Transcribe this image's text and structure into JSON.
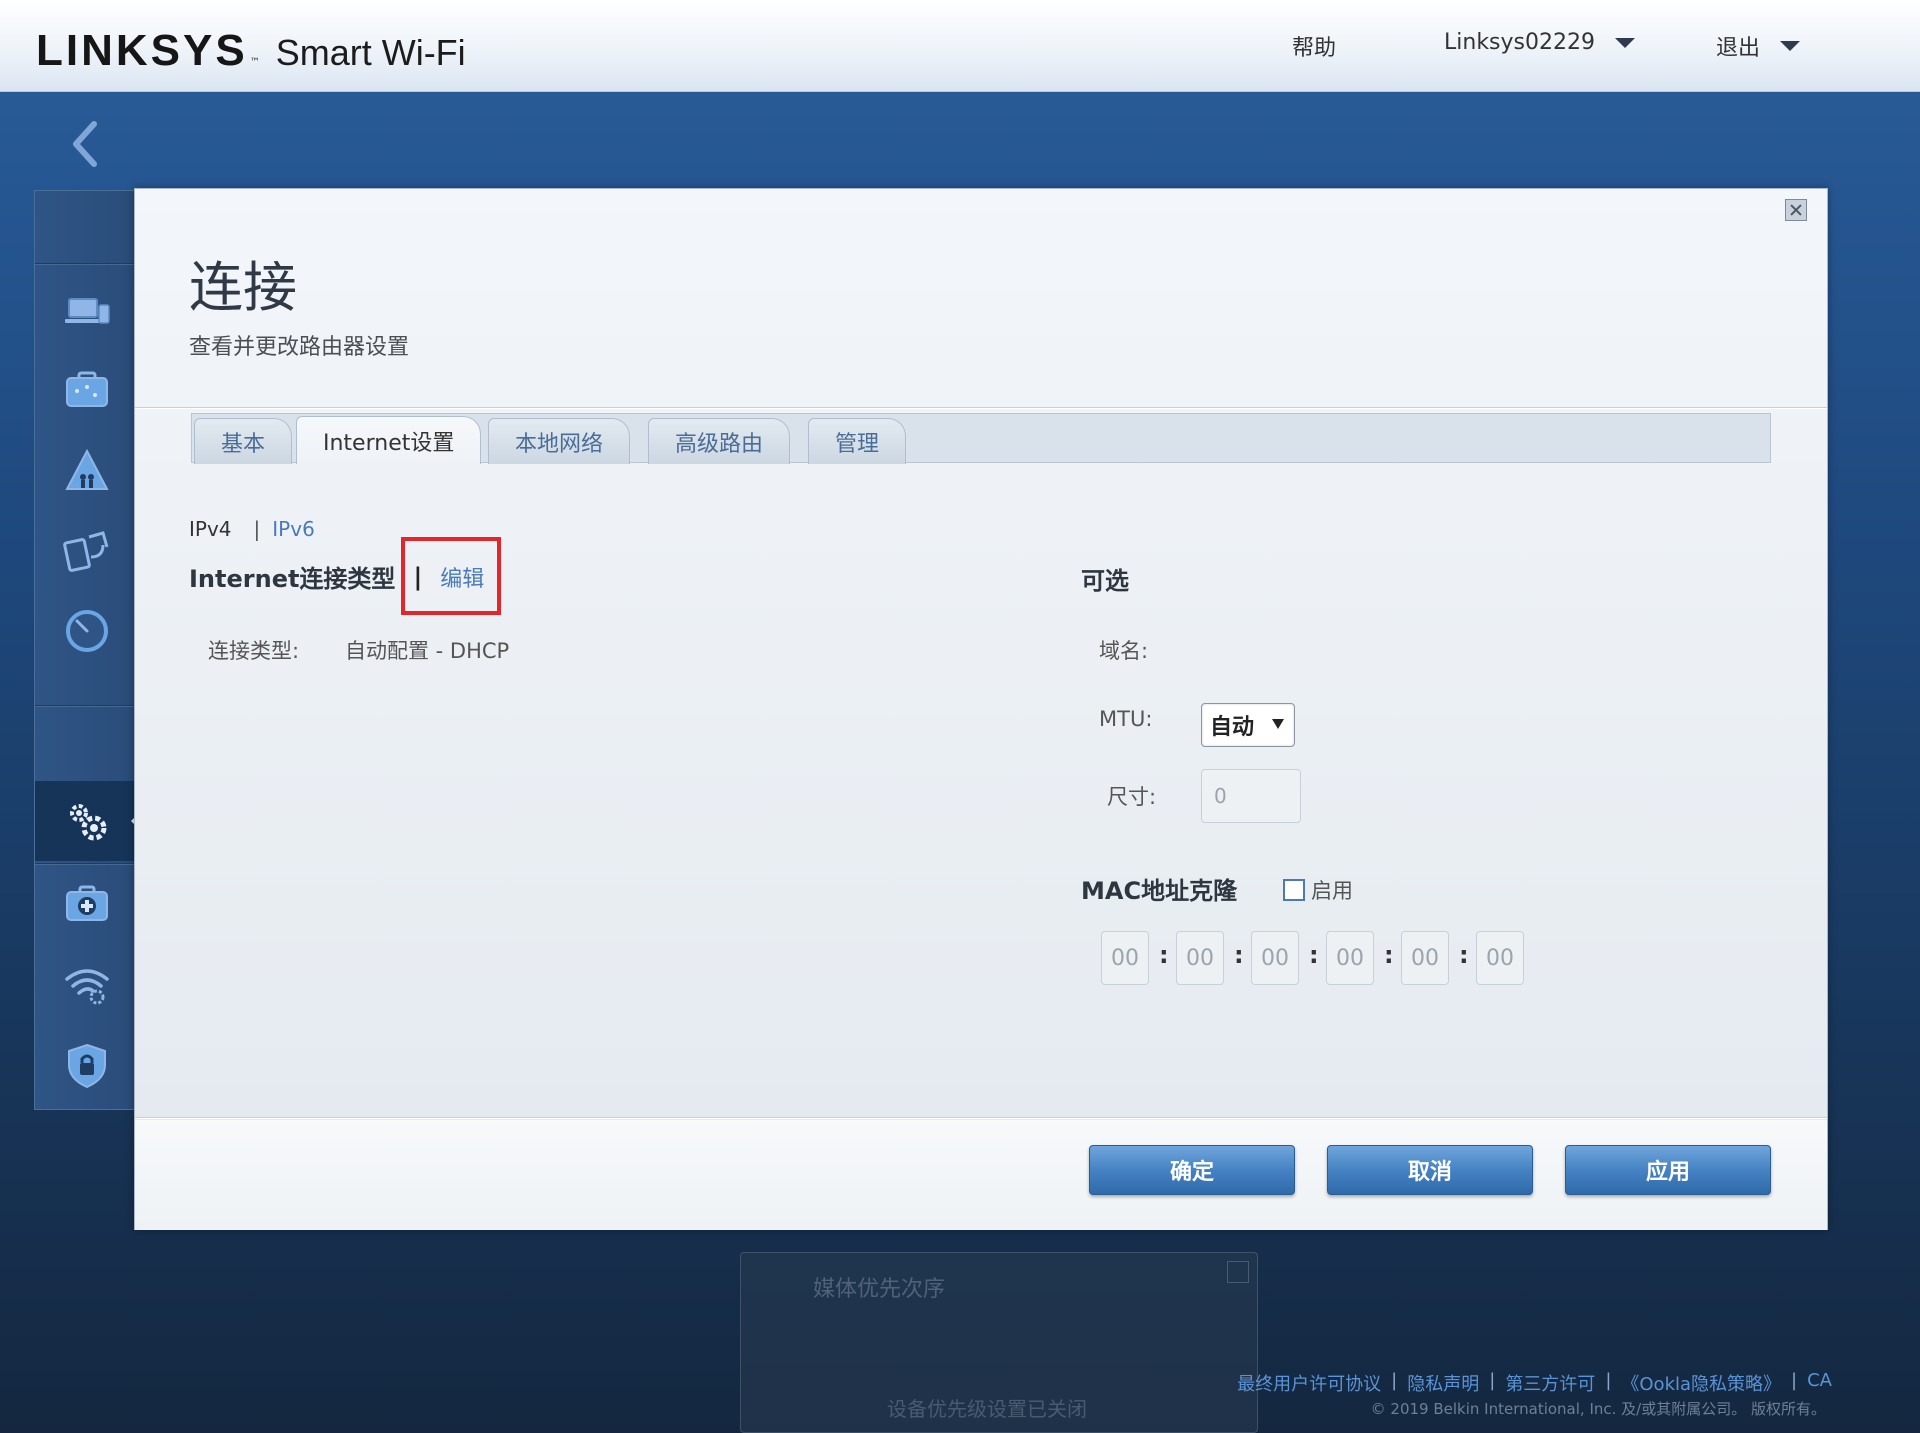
{
  "header": {
    "brand": "LINKSYS",
    "brand_tm": "™",
    "product": "Smart Wi-Fi",
    "help": "帮助",
    "router_name": "Linksys02229",
    "logout": "退出"
  },
  "modal": {
    "title": "连接",
    "subtitle": "查看并更改路由器设置",
    "tabs": [
      {
        "label": "基本"
      },
      {
        "label": "Internet设置"
      },
      {
        "label": "本地网络"
      },
      {
        "label": "高级路由"
      },
      {
        "label": "管理"
      }
    ],
    "sub_tabs": {
      "ipv4": "IPv4",
      "sep": "|",
      "ipv6": "IPv6"
    },
    "internet": {
      "heading": "Internet连接类型",
      "sep": "|",
      "edit": "编辑",
      "conn_label": "连接类型:",
      "conn_value": "自动配置 - DHCP"
    },
    "optional": {
      "heading": "可选",
      "domain_label": "域名:",
      "mtu_label": "MTU:",
      "mtu_value": "自动",
      "size_label": "尺寸:",
      "size_value": "0"
    },
    "mac": {
      "heading": "MAC地址克隆",
      "enable": "启用",
      "fields": [
        "00",
        "00",
        "00",
        "00",
        "00",
        "00"
      ],
      "colon": ":"
    },
    "buttons": {
      "ok": "确定",
      "cancel": "取消",
      "apply": "应用"
    }
  },
  "background_panel": {
    "title": "媒体优先次序",
    "text": "设备优先级设置已关闭"
  },
  "footer": {
    "links": [
      "最终用户许可协议",
      "隐私声明",
      "第三方许可",
      "《Ookla隐私策略》",
      "CA"
    ],
    "separator": "|",
    "copyright": "© 2019 Belkin International, Inc. 及/或其附属公司。 版权所有。"
  },
  "colors": {
    "accent": "#4a7bb7",
    "button": "#4683c4",
    "highlight": "#e1262c"
  }
}
